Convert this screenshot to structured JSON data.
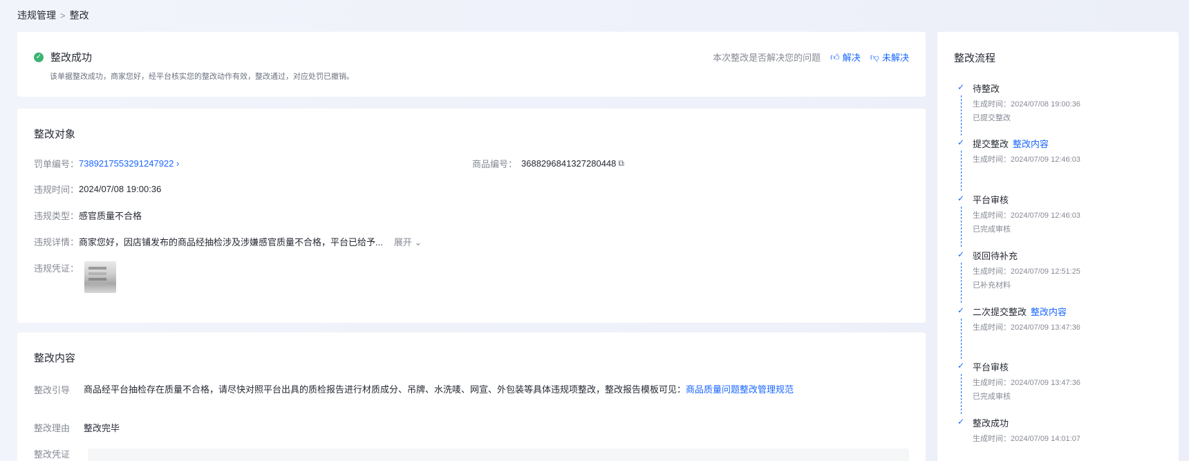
{
  "breadcrumb": {
    "parent": "违规管理",
    "separator": ">",
    "current": "整改"
  },
  "status": {
    "title": "整改成功",
    "description": "该单据整改成功，商家您好，经平台核实您的整改动作有效，整改通过，对应处罚已撤销。",
    "feedback_question": "本次整改是否解决您的问题",
    "resolved_label": "解决",
    "unresolved_label": "未解决"
  },
  "object": {
    "title": "整改对象",
    "penalty_no_label": "罚单编号：",
    "penalty_no": "7389217553291247922",
    "product_no_label": "商品编号：",
    "product_no": "3688296841327280448",
    "violation_time_label": "违规时间：",
    "violation_time": "2024/07/08 19:00:36",
    "violation_type_label": "违规类型：",
    "violation_type": "感官质量不合格",
    "violation_detail_label": "违规详情：",
    "violation_detail": "商家您好，因店铺发布的商品经抽检涉及涉嫌感官质量不合格，平台已给予...",
    "expand_label": "展开",
    "evidence_label": "违规凭证："
  },
  "content": {
    "title": "整改内容",
    "guide_label": "整改引导",
    "guide_text": "商品经平台抽检存在质量不合格，请尽快对照平台出具的质检报告进行材质成分、吊牌、水洗唛、网宣、外包装等具体违规项整改，整改报告模板可见：",
    "guide_link": "商品质量问题整改管理规范",
    "reason_label": "整改理由",
    "reason": "整改完毕",
    "evidence_label": "整改凭证"
  },
  "process": {
    "title": "整改流程",
    "steps": [
      {
        "name": "待整改",
        "link": "",
        "time": "生成时间：2024/07/08 19:00:36",
        "note": "已提交整改"
      },
      {
        "name": "提交整改",
        "link": "整改内容",
        "time": "生成时间：2024/07/09 12:46:03",
        "note": ""
      },
      {
        "name": "平台审核",
        "link": "",
        "time": "生成时间：2024/07/09 12:46:03",
        "note": "已完成审核"
      },
      {
        "name": "驳回待补充",
        "link": "",
        "time": "生成时间：2024/07/09 12:51:25",
        "note": "已补充材料"
      },
      {
        "name": "二次提交整改",
        "link": "整改内容",
        "time": "生成时间：2024/07/09 13:47:36",
        "note": ""
      },
      {
        "name": "平台审核",
        "link": "",
        "time": "生成时间：2024/07/09 13:47:36",
        "note": "已完成审核"
      },
      {
        "name": "整改成功",
        "link": "",
        "time": "生成时间：2024/07/09 14:01:07",
        "note": ""
      }
    ]
  }
}
